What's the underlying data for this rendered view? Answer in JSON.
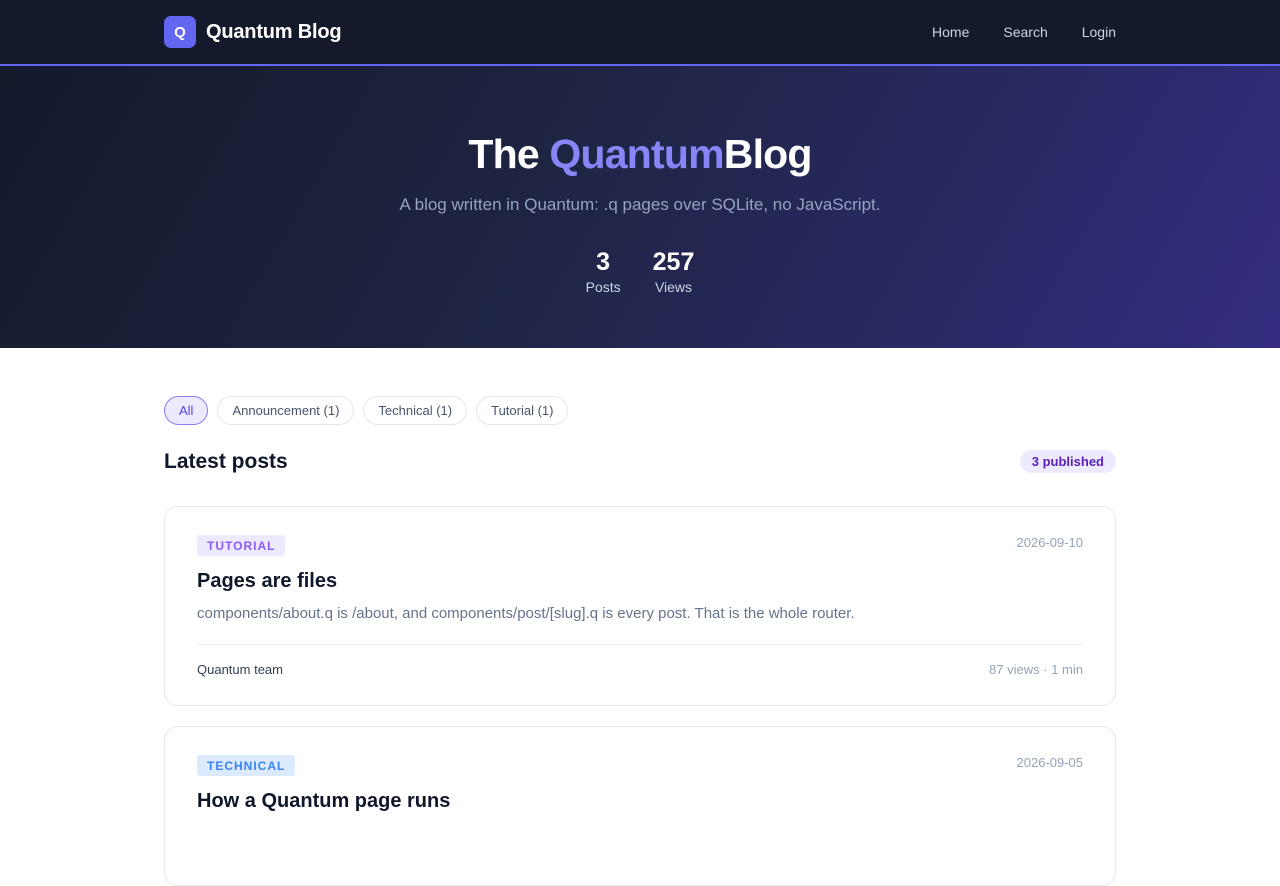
{
  "header": {
    "logo_letter": "Q",
    "brand": "Quantum Blog",
    "nav": [
      "Home",
      "Search",
      "Login"
    ]
  },
  "hero": {
    "title_prefix": "The ",
    "title_accent": "Quantum",
    "title_suffix": "Blog",
    "subtitle": "A blog written in Quantum: .q pages over SQLite, no JavaScript.",
    "stats": [
      {
        "value": "3",
        "label": "Posts"
      },
      {
        "value": "257",
        "label": "Views"
      }
    ]
  },
  "filters": [
    {
      "label": "All",
      "active": true
    },
    {
      "label": "Announcement (1)",
      "active": false
    },
    {
      "label": "Technical (1)",
      "active": false
    },
    {
      "label": "Tutorial (1)",
      "active": false
    }
  ],
  "section": {
    "title": "Latest posts",
    "badge": "3 published"
  },
  "posts": [
    {
      "tag": "TUTORIAL",
      "date": "2026-09-10",
      "title": "Pages are files",
      "excerpt": "components/about.q is /about, and components/post/[slug].q is every post. That is the whole router.",
      "author": "Quantum team",
      "meta": "87 views · 1 min"
    },
    {
      "tag": "TECHNICAL",
      "date": "2026-09-05",
      "title": "How a Quantum page runs"
    }
  ],
  "colors": {
    "accent": "#6366f1",
    "title_accent": "#8b84f7",
    "tag_tutorial": "#8b5cf6",
    "tag_technical": "#3b82f6"
  }
}
